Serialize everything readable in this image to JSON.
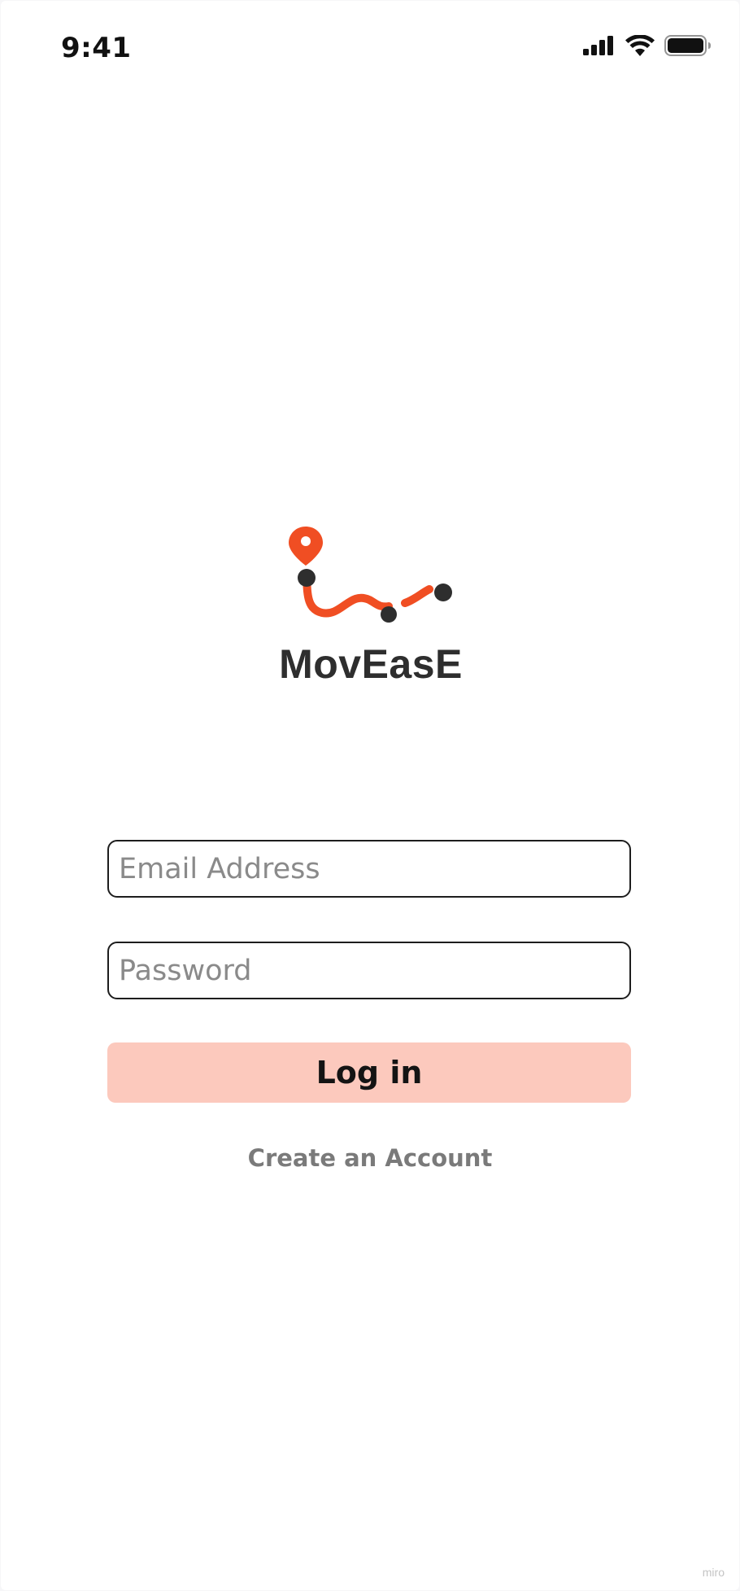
{
  "status_bar": {
    "time": "9:41",
    "icons": [
      "cellular-signal-icon",
      "wifi-icon",
      "battery-icon"
    ]
  },
  "brand": {
    "name": "MovEasE",
    "logo_icon": "route-map-pin-icon",
    "accent_color": "#f04e23",
    "dot_color": "#2e2e2e"
  },
  "login_form": {
    "email_placeholder": "Email Address",
    "email_value": "",
    "password_placeholder": "Password",
    "password_value": "",
    "login_label": "Log in",
    "login_button_color": "#fcc9bd",
    "create_account_label": "Create an Account"
  },
  "watermark": "miro"
}
